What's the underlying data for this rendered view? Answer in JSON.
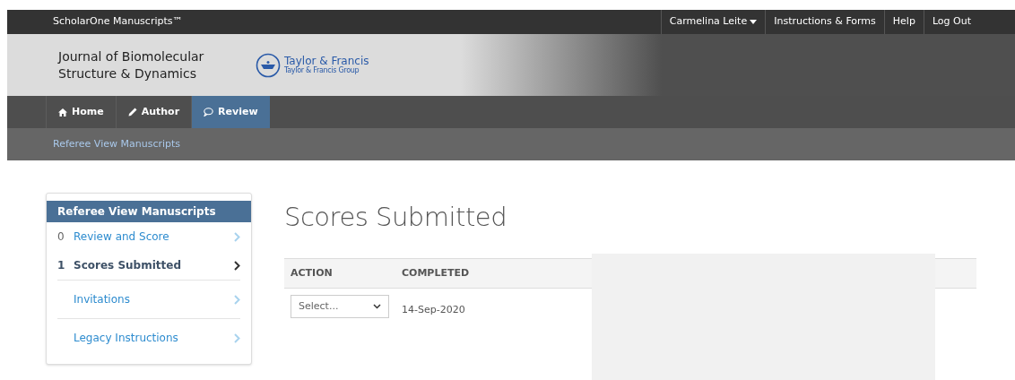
{
  "top_bar": {
    "brand": "ScholarOne Manuscripts™",
    "links": [
      {
        "label": "Carmelina Leite",
        "dropdown": true
      },
      {
        "label": "Instructions & Forms",
        "dropdown": false
      },
      {
        "label": "Help",
        "dropdown": false
      },
      {
        "label": "Log Out",
        "dropdown": false
      }
    ]
  },
  "banner": {
    "journal_title": "Journal of Biomolecular Structure & Dynamics",
    "publisher": "Taylor & Francis",
    "publisher_group": "Taylor & Francis Group"
  },
  "nav_tabs": [
    {
      "label": "Home",
      "kind": "home",
      "selected": false
    },
    {
      "label": "Author",
      "kind": "author",
      "selected": false
    },
    {
      "label": "Review",
      "kind": "review",
      "selected": true
    }
  ],
  "breadcrumb": "Referee View Manuscripts",
  "sidebar": {
    "title": "Referee View Manuscripts",
    "items": [
      {
        "count": "0",
        "label": "Review and Score",
        "selected": false
      },
      {
        "count": "1",
        "label": "Scores Submitted",
        "selected": true
      },
      {
        "label": "Invitations",
        "selected": false
      },
      {
        "label": "Legacy Instructions",
        "selected": false
      }
    ]
  },
  "page_title": "Scores Submitted",
  "table": {
    "columns": [
      "ACTION",
      "COMPLETED"
    ],
    "rows": [
      {
        "action_placeholder": "Select...",
        "completed": "14-Sep-2020"
      }
    ]
  }
}
